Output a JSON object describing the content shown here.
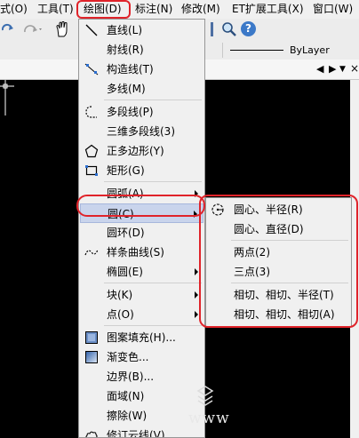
{
  "menubar": {
    "items": [
      {
        "label": "式(O)"
      },
      {
        "label": "工具(T)"
      },
      {
        "label": "绘图(D)"
      },
      {
        "label": "标注(N)"
      },
      {
        "label": "修改(M)"
      },
      {
        "label": "ET扩展工具(X)"
      },
      {
        "label": "窗口(W)"
      }
    ]
  },
  "toolbar": {
    "linetype_value": "ByLayer",
    "help_glyph": "?"
  },
  "draw_menu": {
    "items": [
      {
        "label": "直线(L)",
        "icon": "line-icon"
      },
      {
        "label": "射线(R)",
        "icon": null
      },
      {
        "label": "构造线(T)",
        "icon": "construction-line-icon"
      },
      {
        "label": "多线(M)",
        "icon": null
      },
      {
        "label": "多段线(P)",
        "icon": "polyline-icon"
      },
      {
        "label": "三维多段线(3)",
        "icon": null
      },
      {
        "label": "正多边形(Y)",
        "icon": "polygon-icon"
      },
      {
        "label": "矩形(G)",
        "icon": "rectangle-icon"
      },
      {
        "label": "圆弧(A)",
        "icon": null,
        "submenu": true
      },
      {
        "label": "圆(C)",
        "icon": null,
        "submenu": true,
        "highlighted": true
      },
      {
        "label": "圆环(D)",
        "icon": null
      },
      {
        "label": "样条曲线(S)",
        "icon": "spline-icon"
      },
      {
        "label": "椭圆(E)",
        "icon": null,
        "submenu": true
      },
      {
        "label": "块(K)",
        "icon": null,
        "submenu": true
      },
      {
        "label": "点(O)",
        "icon": null,
        "submenu": true
      },
      {
        "label": "图案填充(H)...",
        "icon": "hatch-icon"
      },
      {
        "label": "渐变色...",
        "icon": "gradient-icon"
      },
      {
        "label": "边界(B)...",
        "icon": null
      },
      {
        "label": "面域(N)",
        "icon": null
      },
      {
        "label": "擦除(W)",
        "icon": null
      },
      {
        "label": "修订云线(V)",
        "icon": "revision-cloud-icon"
      }
    ]
  },
  "circle_submenu": {
    "items": [
      {
        "label": "圆心、半径(R)",
        "icon": "circle-center-radius-icon"
      },
      {
        "label": "圆心、直径(D)",
        "icon": null
      },
      {
        "label": "两点(2)",
        "icon": null
      },
      {
        "label": "三点(3)",
        "icon": null
      },
      {
        "label": "相切、相切、半径(T)",
        "icon": null
      },
      {
        "label": "相切、相切、相切(A)",
        "icon": null
      }
    ]
  },
  "watermark": {
    "text": "www"
  },
  "colors": {
    "highlight": "#c9d4ec",
    "callout_red": "#e0232a",
    "menu_bg": "#f0f0f0",
    "canvas_bg": "#000000"
  }
}
